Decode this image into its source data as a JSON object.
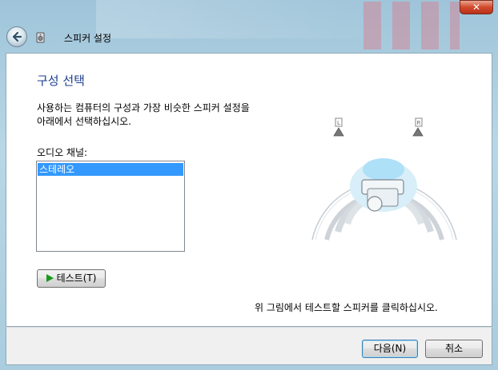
{
  "window": {
    "title": "스피커 설정",
    "close_label": "✕"
  },
  "page": {
    "heading": "구성 선택",
    "description_line1": "사용하는 컴퓨터의 구성과 가장 비슷한 스피커 설정을",
    "description_line2": "아래에서 선택하십시오.",
    "channel_label": "오디오 채널:",
    "channels": [
      "스테레오"
    ],
    "selected_channel": "스테레오",
    "test_button": "테스트(T)",
    "hint": "위 그림에서 테스트할 스피커를 클릭하십시오."
  },
  "diagram": {
    "left_speaker_label": "L",
    "right_speaker_label": "R"
  },
  "footer": {
    "next_button": "다음(N)",
    "cancel_button": "취소"
  },
  "colors": {
    "heading": "#1e3e8c",
    "selection": "#3399ff",
    "play_icon": "#1a9a1a",
    "close_button": "#d24a2c"
  }
}
